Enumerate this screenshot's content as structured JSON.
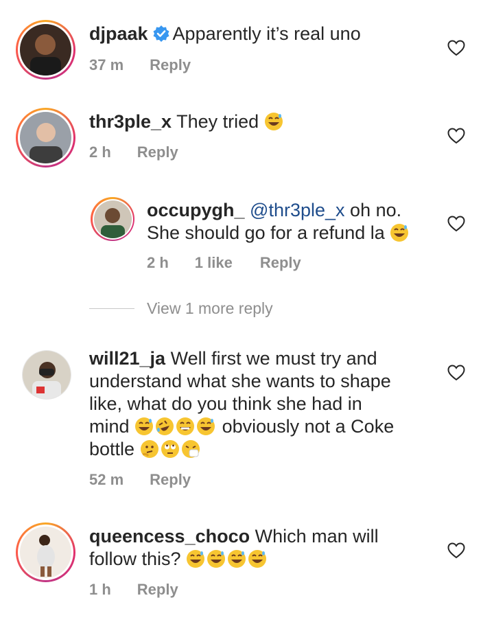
{
  "comments": [
    {
      "username": "djpaak",
      "verified": true,
      "text": "Apparently it’s real uno",
      "time": "37 m",
      "likes": "",
      "reply_label": "Reply"
    },
    {
      "username": "thr3ple_x",
      "text": "They tried",
      "emojis": [
        "grinning-sweat-emoji"
      ],
      "time": "2 h",
      "reply_label": "Reply"
    },
    {
      "username": "occupygh_",
      "mention": "@thr3ple_x",
      "text_line1": "oh no.",
      "text_line2": "She should go for a refund la",
      "emojis": [
        "grinning-sweat-emoji"
      ],
      "time": "2 h",
      "likes": "1 like",
      "reply_label": "Reply",
      "is_reply": true
    },
    {
      "username": "will21_ja",
      "text_line1": "Well first we must try and",
      "text_line2": "understand what she wants to shape",
      "text_line3": "like, what do you think she had in",
      "text_line4a": "mind",
      "text_line4b": "obviously not a Coke",
      "text_line5": "bottle",
      "time": "52 m",
      "reply_label": "Reply"
    },
    {
      "username": "queencess_choco",
      "text_line1": "Which man will",
      "text_line2": "follow this?",
      "time": "1 h",
      "reply_label": "Reply"
    }
  ],
  "view_more_label": "View 1 more reply",
  "colors": {
    "meta": "#8e8e8e",
    "mention": "#1f4d8c",
    "verified": "#3897f0",
    "emoji": "#f7c531"
  }
}
